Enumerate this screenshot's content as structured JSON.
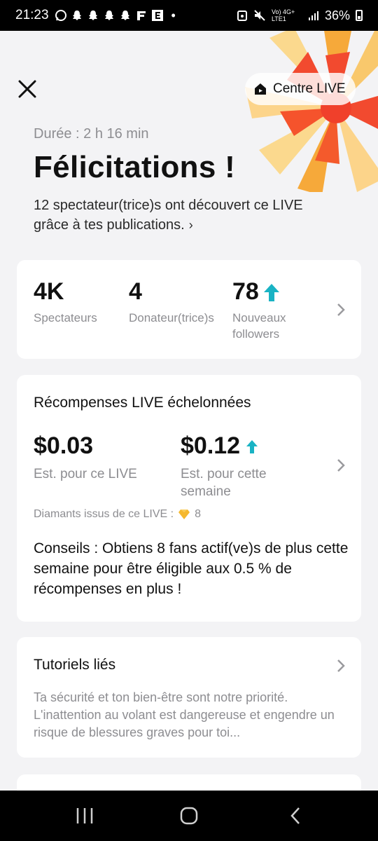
{
  "status_bar": {
    "time": "21:23",
    "network": "Vo) 4G+ LTE1",
    "battery": "36%"
  },
  "header": {
    "centre_live_label": "Centre LIVE"
  },
  "summary": {
    "duration": "Durée : 2 h 16 min",
    "title": "Félicitations !",
    "subtitle": "12 spectateur(trice)s ont découvert ce LIVE grâce à tes publications."
  },
  "stats": [
    {
      "value": "4K",
      "label": "Spectateurs"
    },
    {
      "value": "4",
      "label": "Donateur(trice)s"
    },
    {
      "value": "78",
      "label": "Nouveaux followers"
    }
  ],
  "rewards": {
    "title": "Récompenses LIVE échelonnées",
    "live_value": "$0.03",
    "live_label": "Est. pour ce LIVE",
    "week_value": "$0.12",
    "week_label": "Est. pour cette semaine",
    "diamonds_label": "Diamants issus de ce LIVE :",
    "diamonds_count": "8",
    "tip": "Conseils : Obtiens 8 fans actif(ve)s de plus cette semaine pour être éligible aux 0.5 % de récompenses en plus !"
  },
  "tutorials": {
    "title": "Tutoriels liés",
    "text": "Ta sécurité et ton bien-être sont notre priorité. L'inattention au volant est dangereuse et engendre un risque de blessures graves pour toi..."
  },
  "colors": {
    "accent_up": "#19b3c4",
    "muted": "#8d8d91",
    "background": "#f3f3f5"
  }
}
